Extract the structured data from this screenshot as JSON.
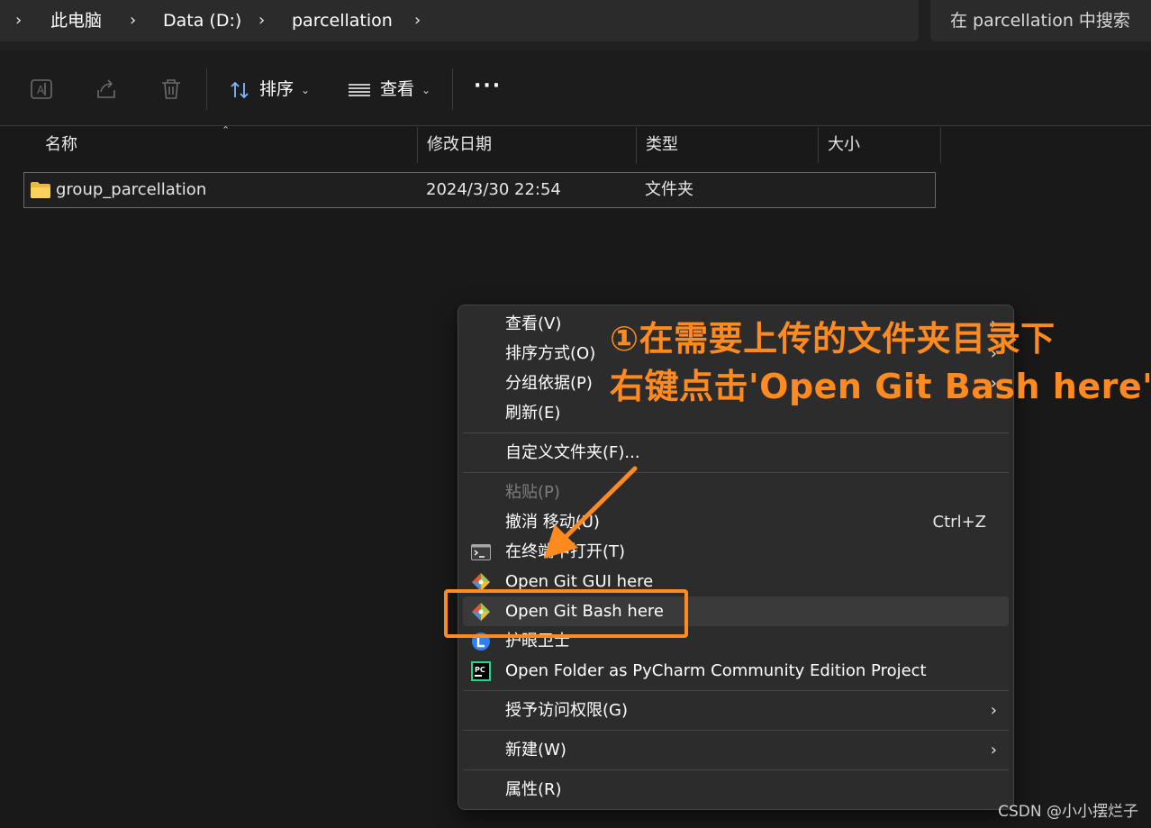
{
  "breadcrumb": {
    "items": [
      "此电脑",
      "Data (D:)",
      "parcellation"
    ]
  },
  "search": {
    "placeholder": "在 parcellation 中搜索"
  },
  "toolbar": {
    "sort_label": "排序",
    "view_label": "查看",
    "more_label": "···",
    "icons": [
      "rename-icon",
      "share-icon",
      "delete-icon"
    ]
  },
  "columns": {
    "name": "名称",
    "date": "修改日期",
    "type": "类型",
    "size": "大小"
  },
  "files": [
    {
      "name": "group_parcellation",
      "date": "2024/3/30 22:54",
      "type": "文件夹",
      "size": ""
    }
  ],
  "context_menu": {
    "view": "查看(V)",
    "sort_by": "排序方式(O)",
    "group_by": "分组依据(P)",
    "refresh": "刷新(E)",
    "customize": "自定义文件夹(F)...",
    "paste": "粘贴(P)",
    "undo_move": "撤消 移动(U)",
    "undo_shortcut": "Ctrl+Z",
    "open_terminal": "在终端中打开(T)",
    "git_gui": "Open Git GUI here",
    "git_bash": "Open Git Bash here",
    "eye_guard": "护眼卫士",
    "pycharm": "Open Folder as PyCharm Community Edition Project",
    "grant_access": "授予访问权限(G)",
    "new": "新建(W)",
    "properties": "属性(R)"
  },
  "annotation": {
    "line1": "①在需要上传的文件夹目录下",
    "line2": "右键点击'Open Git Bash here'",
    "color": "#ff8a1f"
  },
  "watermark": "CSDN @小小摆烂子"
}
